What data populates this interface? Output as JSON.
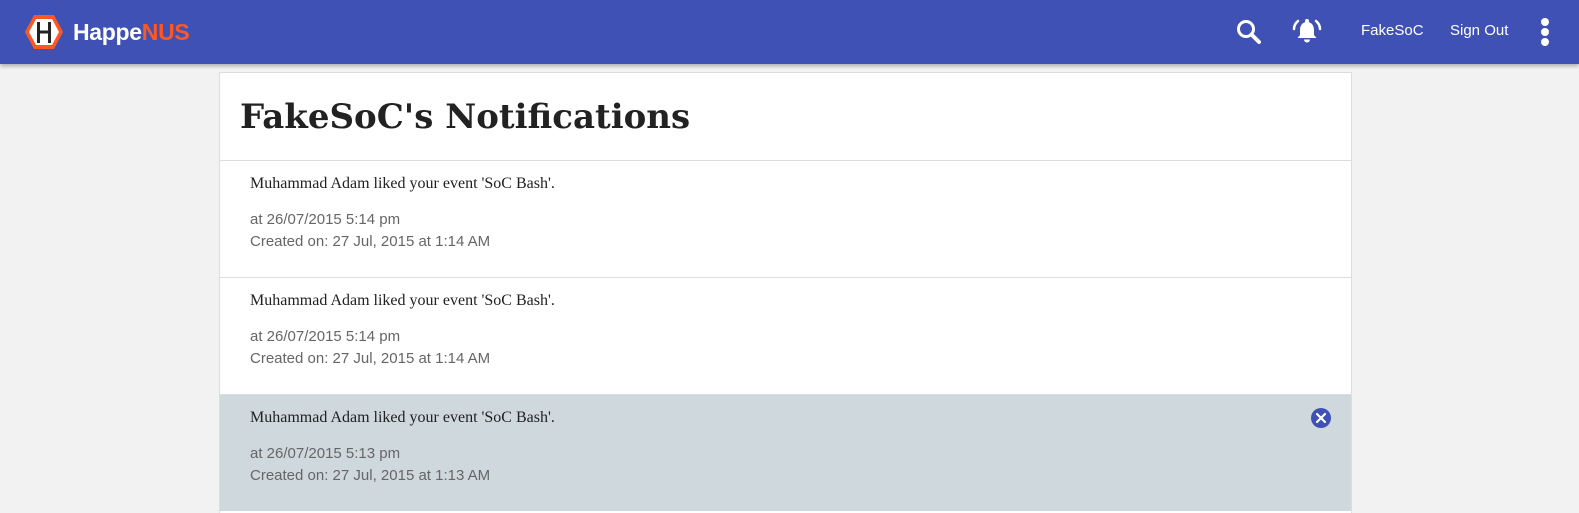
{
  "header": {
    "brand_part1": "Happe",
    "brand_part2": "NUS",
    "user_link": "FakeSoC",
    "signout_label": "Sign Out",
    "icons": [
      "logo-hexagon-h",
      "search-icon",
      "bell-ringing-icon",
      "more-vert-icon"
    ]
  },
  "colors": {
    "navbar": "#3f51b5",
    "brand_accent": "#ff5722",
    "highlight_row": "#cfd8dc",
    "dismiss_icon": "#3f51b5"
  },
  "page": {
    "title": "FakeSoC's Notifications"
  },
  "notifications": [
    {
      "message": "Muhammad Adam liked your event 'SoC Bash'.",
      "time": "at 26/07/2015 5:14 pm",
      "created": "Created on: 27 Jul, 2015 at 1:14 AM"
    },
    {
      "message": "Muhammad Adam liked your event 'SoC Bash'.",
      "time": "at 26/07/2015 5:14 pm",
      "created": "Created on: 27 Jul, 2015 at 1:14 AM"
    },
    {
      "message": "Muhammad Adam liked your event 'SoC Bash'.",
      "time": "at 26/07/2015 5:13 pm",
      "created": "Created on: 27 Jul, 2015 at 1:13 AM",
      "highlighted": true
    }
  ]
}
